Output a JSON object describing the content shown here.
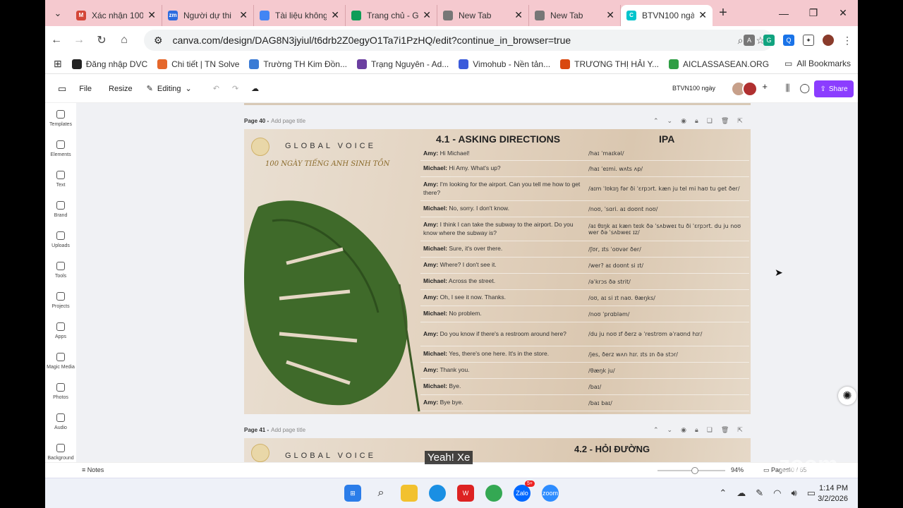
{
  "browser": {
    "tabs": [
      {
        "title": "Xác nhận 100",
        "color": "#d44638",
        "icon": "M"
      },
      {
        "title": "Người dự thi",
        "color": "#2d6cdf",
        "icon": "zm"
      },
      {
        "title": "Tài liệu không",
        "color": "#4285f4",
        "icon": ""
      },
      {
        "title": "Trang chủ - G",
        "color": "#0f9d58",
        "icon": ""
      },
      {
        "title": "New Tab",
        "color": "#777777",
        "icon": ""
      },
      {
        "title": "New Tab",
        "color": "#777777",
        "icon": ""
      },
      {
        "title": "BTVN100 ngà",
        "color": "#00c4cc",
        "icon": "C"
      }
    ],
    "url": "canva.com/design/DAG8N3jyiul/t6drb2Z0egyO1Ta7i1PzHQ/edit?continue_in_browser=true",
    "bookmarks": [
      "Đăng nhập DVC",
      "Chi tiết | TN Solve",
      "Trường TH Kim Đồn...",
      "Trạng Nguyên - Ad...",
      "Vimohub - Nền tản...",
      "TRƯƠNG THỊ HẢI Y...",
      "AICLASSASEAN.ORG"
    ],
    "all_bookmarks": "All Bookmarks"
  },
  "canva": {
    "file": "File",
    "resize": "Resize",
    "editing": "Editing",
    "doc_title": "BTVN100 ngày",
    "share": "Share",
    "sidebar": [
      "Templates",
      "Elements",
      "Text",
      "Brand",
      "Uploads",
      "Tools",
      "Projects",
      "Apps",
      "Magic Media",
      "Photos",
      "Audio",
      "Background"
    ],
    "notes": "Notes",
    "zoom": "94%",
    "pages_label": "Pages",
    "page_count": "40 / 65"
  },
  "page40": {
    "label": "Page 40 -",
    "add_title": "Add page title",
    "brand": "GLOBAL VOICE",
    "tagline": "100 NGÀY TIẾNG ANH SINH TỒN",
    "heading": "4.1 - ASKING DIRECTIONS",
    "ipa_heading": "IPA",
    "rows": [
      {
        "speaker": "Amy:",
        "text": "Hi Michael!",
        "ipa": "/haɪ ˈmaɪkəl/"
      },
      {
        "speaker": "Michael:",
        "text": "Hi Amy. What's up?",
        "ipa": "/haɪ ˈeɪmi. wʌts ʌp/"
      },
      {
        "speaker": "Amy:",
        "text": "I'm looking for the airport. Can you tell me how to get there?",
        "ipa": "/aɪm ˈlʊkɪŋ fər ði ˈɛrpɔrt. kæn ju tel mi haʊ tu get ðer/"
      },
      {
        "speaker": "Michael:",
        "text": "No, sorry. I don't know.",
        "ipa": "/noʊ, ˈsɑri. aɪ doʊnt noʊ/"
      },
      {
        "speaker": "Amy:",
        "text": "I think I can take the subway to the airport. Do you know where the subway is?",
        "ipa": "/aɪ θɪŋk aɪ kæn teɪk ðə ˈsʌbweɪ tu ði ˈɛrpɔrt. du ju noʊ wer ðə ˈsʌbweɪ ɪz/"
      },
      {
        "speaker": "Michael:",
        "text": "Sure, it's over there.",
        "ipa": "/ʃʊr, ɪts ˈoʊvər ðer/"
      },
      {
        "speaker": "Amy:",
        "text": "Where? I don't see it.",
        "ipa": "/wer? aɪ doʊnt si ɪt/"
      },
      {
        "speaker": "Michael:",
        "text": "Across the street.",
        "ipa": "/əˈkrɔs ðə strit/"
      },
      {
        "speaker": "Amy:",
        "text": "Oh, I see it now. Thanks.",
        "ipa": "/oʊ, aɪ si ɪt naʊ. θæŋks/"
      },
      {
        "speaker": "Michael:",
        "text": "No problem.",
        "ipa": "/noʊ ˈprɑbləm/"
      },
      {
        "speaker": "Amy:",
        "text": "Do you know if there's a restroom around here?",
        "ipa": "/du ju noʊ ɪf ðerz ə ˈrestrʊm əˈraʊnd hɪr/"
      },
      {
        "speaker": "Michael:",
        "text": "Yes, there's one here. It's in the store.",
        "ipa": "/jes, ðerz wʌn hɪr. ɪts ɪn ðə stɔr/"
      },
      {
        "speaker": "Amy:",
        "text": "Thank you.",
        "ipa": "/θæŋk ju/"
      },
      {
        "speaker": "Michael:",
        "text": "Bye.",
        "ipa": "/baɪ/"
      },
      {
        "speaker": "Amy:",
        "text": "Bye bye.",
        "ipa": "/baɪ baɪ/"
      }
    ]
  },
  "page41": {
    "label": "Page 41 -",
    "add_title": "Add page title",
    "brand": "GLOBAL VOICE",
    "heading": "4.2 - HỎI ĐƯỜNG"
  },
  "overlay": {
    "caption": "Yeah! Xe",
    "watermark": "zoom"
  },
  "taskbar": {
    "time": "1:14 PM",
    "date": "3/2/2026",
    "zalo_badge": "5+"
  }
}
